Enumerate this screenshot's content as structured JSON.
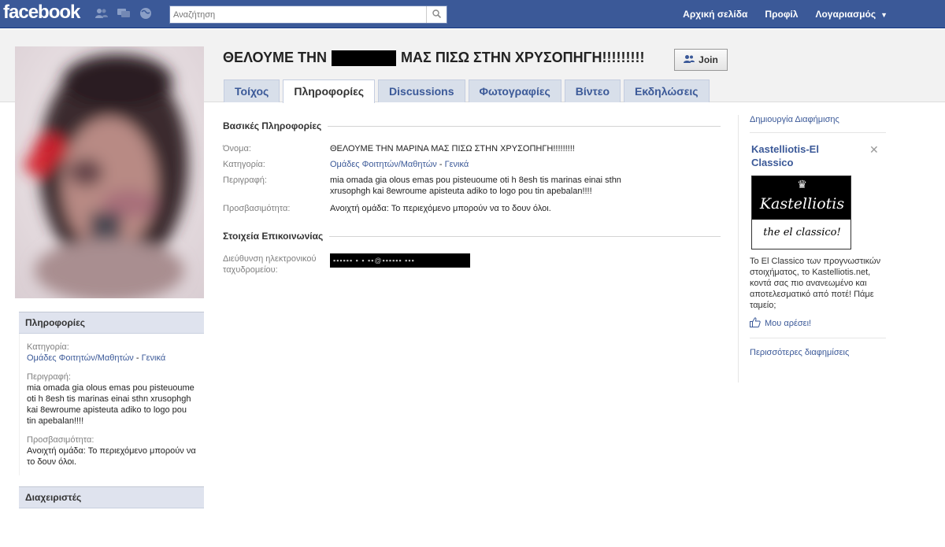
{
  "topbar": {
    "logo": "facebook",
    "search_placeholder": "Αναζήτηση",
    "nav": {
      "home": "Αρχική σελίδα",
      "profile": "Προφίλ",
      "account": "Λογαριασμός"
    }
  },
  "group": {
    "title_prefix": "ΘΕΛΟΥΜΕ ΤΗΝ",
    "title_suffix": "ΜΑΣ ΠΙΣΩ ΣΤΗΝ ΧΡΥΣΟΠΗΓΗ!!!!!!!!!",
    "join_label": "Join"
  },
  "tabs": [
    {
      "label": "Τοίχος",
      "active": false
    },
    {
      "label": "Πληροφορίες",
      "active": true
    },
    {
      "label": "Discussions",
      "active": false
    },
    {
      "label": "Φωτογραφίες",
      "active": false
    },
    {
      "label": "Βίντεο",
      "active": false
    },
    {
      "label": "Εκδηλώσεις",
      "active": false
    }
  ],
  "basic_info": {
    "section_title": "Βασικές Πληροφορίες",
    "name_label": "Όνομα:",
    "name_value": "ΘΕΛΟΥΜΕ ΤΗΝ ΜΑΡΙΝΑ ΜΑΣ ΠΙΣΩ ΣΤΗΝ ΧΡΥΣΟΠΗΓΗ!!!!!!!!!",
    "category_label": "Κατηγορία:",
    "category_link": "Ομάδες Φοιτητών/Μαθητών",
    "category_sep": " - ",
    "category_sub": "Γενικά",
    "description_label": "Περιγραφή:",
    "description_value": "mia omada gia olous emas pou pisteuoume oti h 8esh tis marinas einai sthn xrusophgh kai 8ewroume apisteuta adiko to logo pou tin apebalan!!!!",
    "access_label": "Προσβασιμότητα:",
    "access_value": "Ανοιχτή ομάδα: Το περιεχόμενο μπορούν να το δουν όλοι."
  },
  "contact_info": {
    "section_title": "Στοιχεία Επικοινωνίας",
    "email_label": "Διεύθυνση ηλεκτρονικού ταχυδρομείου:"
  },
  "left_box": {
    "title": "Πληροφορίες",
    "category_label": "Κατηγορία:",
    "category_link": "Ομάδες Φοιτητών/Μαθητών",
    "category_sep": " - ",
    "category_sub": "Γενικά",
    "description_label": "Περιγραφή:",
    "description_value": "mia omada gia olous emas pou pisteuoume oti h 8esh tis marinas einai sthn xrusophgh kai 8ewroume apisteuta adiko to logo pou tin apebalan!!!!",
    "access_label": "Προσβασιμότητα:",
    "access_value": "Ανοιχτή ομάδα: Το περιεχόμενο μπορούν να το δουν όλοι.",
    "admins_title": "Διαχειριστές"
  },
  "ads": {
    "create_ad": "Δημιουργία Διαφήμισης",
    "ad_title": "Kastelliotis-El Classico",
    "ad_image_brand": "Kastelliotis",
    "ad_image_tag": "the el classico!",
    "ad_text": "Το El Classico των προγνωστικών στοιχήματος, το Kastelliotis.net, κοντά σας πιο ανανεωμένο και αποτελεσματικό από ποτέ! Πάμε ταμείο;",
    "like_label": "Μου αρέσει!",
    "more_ads": "Περισσότερες διαφημίσεις"
  },
  "colors": {
    "brand_blue": "#3b5998",
    "tab_bg": "#d8dfea",
    "header_gray": "#f2f2f2"
  }
}
